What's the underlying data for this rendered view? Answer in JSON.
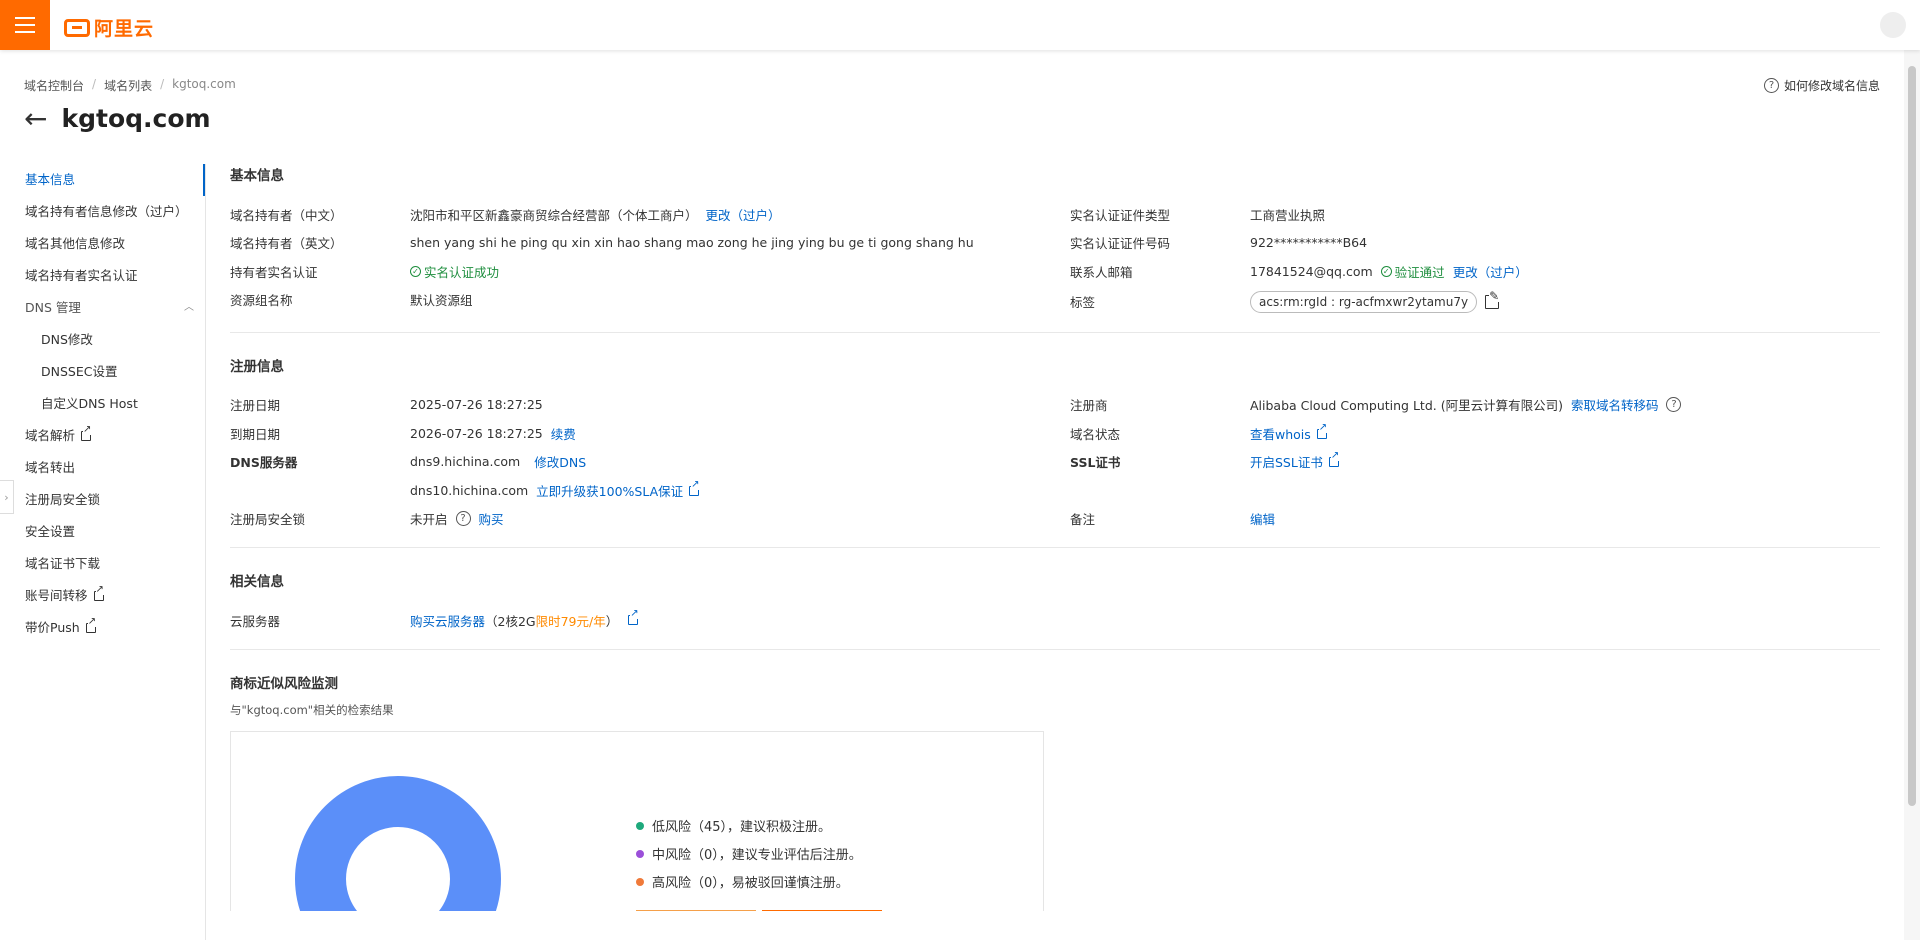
{
  "topbar": {
    "logo_text": "阿里云"
  },
  "breadcrumb": [
    "域名控制台",
    "域名列表",
    "kgtoq.com"
  ],
  "breadcrumb_sep": "/",
  "help_link": "如何修改域名信息",
  "page_title": "kgtoq.com",
  "sidebar": {
    "items": [
      {
        "label": "基本信息",
        "active": true
      },
      {
        "label": "域名持有者信息修改（过户）"
      },
      {
        "label": "域名其他信息修改"
      },
      {
        "label": "域名持有者实名认证"
      },
      {
        "label": "DNS 管理",
        "expandable": true
      },
      {
        "label": "DNS修改",
        "sub": true
      },
      {
        "label": "DNSSEC设置",
        "sub": true
      },
      {
        "label": "自定义DNS Host",
        "sub": true
      },
      {
        "label": "域名解析",
        "external": true
      },
      {
        "label": "域名转出"
      },
      {
        "label": "注册局安全锁"
      },
      {
        "label": "安全设置"
      },
      {
        "label": "域名证书下载"
      },
      {
        "label": "账号间转移",
        "external": true
      },
      {
        "label": "带价Push",
        "external": true
      }
    ]
  },
  "basic": {
    "title": "基本信息",
    "owner_cn_label": "域名持有者（中文）",
    "owner_cn_value": "沈阳市和平区新鑫豪商贸综合经营部（个体工商户）",
    "owner_cn_link": "更改（过户）",
    "owner_en_label": "域名持有者（英文）",
    "owner_en_value": "shen yang shi he ping qu xin xin hao shang mao zong he jing ying bu ge ti gong shang hu",
    "realname_label": "持有者实名认证",
    "realname_value": "实名认证成功",
    "rg_label": "资源组名称",
    "rg_value": "默认资源组",
    "cert_type_label": "实名认证证件类型",
    "cert_type_value": "工商营业执照",
    "cert_no_label": "实名认证证件号码",
    "cert_no_value": "922***********B64",
    "email_label": "联系人邮箱",
    "email_value": "17841524@qq.com",
    "email_status": "验证通过",
    "email_link": "更改（过户）",
    "tag_label": "标签",
    "tag_value": "acs:rm:rgId : rg-acfmxwr2ytamu7y"
  },
  "reg": {
    "title": "注册信息",
    "reg_date_label": "注册日期",
    "reg_date_value": "2025-07-26 18:27:25",
    "exp_date_label": "到期日期",
    "exp_date_value": "2026-07-26 18:27:25",
    "renew_link": "续费",
    "dns_label": "DNS服务器",
    "dns1": "dns9.hichina.com",
    "dns1_link": "修改DNS",
    "dns2": "dns10.hichina.com",
    "dns2_link": "立即升级获100%SLA保证",
    "lock_label": "注册局安全锁",
    "lock_value": "未开启",
    "lock_link": "购买",
    "registrar_label": "注册商",
    "registrar_value": "Alibaba Cloud Computing Ltd. (阿里云计算有限公司)",
    "registrar_link": "索取域名转移码",
    "status_label": "域名状态",
    "status_link": "查看whois",
    "ssl_label": "SSL证书",
    "ssl_link": "开启SSL证书",
    "remark_label": "备注",
    "remark_link": "编辑"
  },
  "related": {
    "title": "相关信息",
    "server_label": "云服务器",
    "server_link": "购买云服务器",
    "server_note_pre": "（2核2G",
    "server_note_promo": "限时79元/年",
    "server_note_post": "）"
  },
  "risk": {
    "title": "商标近似风险监测",
    "subtitle": "与\"kgtoq.com\"相关的检索结果",
    "legend": [
      {
        "label": "低风险（45），建议积极注册。",
        "color": "#1ea97c"
      },
      {
        "label": "中风险（0），建议专业评估后注册。",
        "color": "#9b4fd9"
      },
      {
        "label": "高风险（0），易被驳回谨慎注册。",
        "color": "#f07a3a"
      }
    ],
    "chart_data": {
      "type": "pie",
      "categories": [
        "低风险",
        "中风险",
        "高风险"
      ],
      "values": [
        45,
        0,
        0
      ],
      "colors": [
        "#5b8ff9",
        "#9b4fd9",
        "#f07a3a"
      ]
    }
  }
}
